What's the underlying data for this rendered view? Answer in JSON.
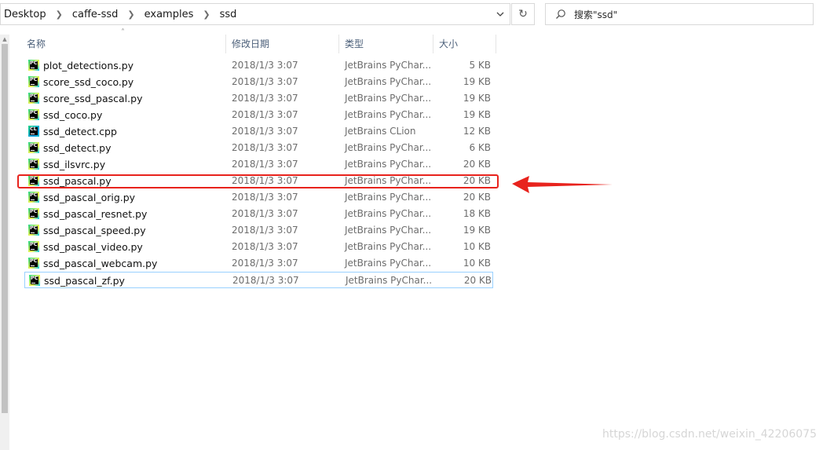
{
  "address": {
    "crumbs": [
      "Desktop",
      "caffe-ssd",
      "examples",
      "ssd"
    ]
  },
  "search": {
    "placeholder": "搜索\"ssd\""
  },
  "columns": {
    "name": "名称",
    "modified": "修改日期",
    "type": "类型",
    "size": "大小"
  },
  "files": [
    {
      "name": "plot_detections.py",
      "date": "2018/1/3 3:07",
      "type": "JetBrains PyChar...",
      "size": "5 KB",
      "icon": "pycharm-icon"
    },
    {
      "name": "score_ssd_coco.py",
      "date": "2018/1/3 3:07",
      "type": "JetBrains PyChar...",
      "size": "19 KB",
      "icon": "pycharm-icon"
    },
    {
      "name": "score_ssd_pascal.py",
      "date": "2018/1/3 3:07",
      "type": "JetBrains PyChar...",
      "size": "19 KB",
      "icon": "pycharm-icon"
    },
    {
      "name": "ssd_coco.py",
      "date": "2018/1/3 3:07",
      "type": "JetBrains PyChar...",
      "size": "19 KB",
      "icon": "pycharm-icon"
    },
    {
      "name": "ssd_detect.cpp",
      "date": "2018/1/3 3:07",
      "type": "JetBrains CLion",
      "size": "12 KB",
      "icon": "clion-icon"
    },
    {
      "name": "ssd_detect.py",
      "date": "2018/1/3 3:07",
      "type": "JetBrains PyChar...",
      "size": "6 KB",
      "icon": "pycharm-icon"
    },
    {
      "name": "ssd_ilsvrc.py",
      "date": "2018/1/3 3:07",
      "type": "JetBrains PyChar...",
      "size": "20 KB",
      "icon": "pycharm-icon"
    },
    {
      "name": "ssd_pascal.py",
      "date": "2018/1/3 3:07",
      "type": "JetBrains PyChar...",
      "size": "20 KB",
      "icon": "pycharm-icon"
    },
    {
      "name": "ssd_pascal_orig.py",
      "date": "2018/1/3 3:07",
      "type": "JetBrains PyChar...",
      "size": "20 KB",
      "icon": "pycharm-icon"
    },
    {
      "name": "ssd_pascal_resnet.py",
      "date": "2018/1/3 3:07",
      "type": "JetBrains PyChar...",
      "size": "18 KB",
      "icon": "pycharm-icon"
    },
    {
      "name": "ssd_pascal_speed.py",
      "date": "2018/1/3 3:07",
      "type": "JetBrains PyChar...",
      "size": "19 KB",
      "icon": "pycharm-icon"
    },
    {
      "name": "ssd_pascal_video.py",
      "date": "2018/1/3 3:07",
      "type": "JetBrains PyChar...",
      "size": "10 KB",
      "icon": "pycharm-icon"
    },
    {
      "name": "ssd_pascal_webcam.py",
      "date": "2018/1/3 3:07",
      "type": "JetBrains PyChar...",
      "size": "10 KB",
      "icon": "pycharm-icon"
    },
    {
      "name": "ssd_pascal_zf.py",
      "date": "2018/1/3 3:07",
      "type": "JetBrains PyChar...",
      "size": "20 KB",
      "icon": "pycharm-icon"
    }
  ],
  "icon_labels": {
    "pycharm": "PC",
    "clion": "CL"
  },
  "watermark": "https://blog.csdn.net/weixin_42206075",
  "colors": {
    "annotation": "#e8231d",
    "selection_border": "#99d1ff",
    "header_text": "#4c607a"
  }
}
